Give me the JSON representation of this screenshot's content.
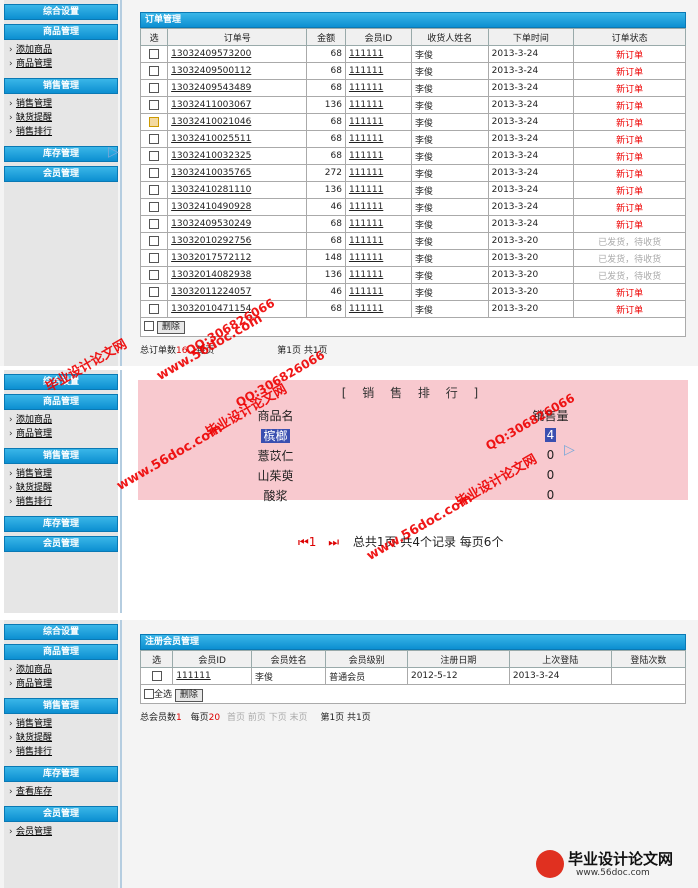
{
  "sidebar1": {
    "sections": [
      {
        "header": "综合设置",
        "items": []
      },
      {
        "header": "商品管理",
        "items": [
          "添加商品",
          "商品管理"
        ]
      },
      {
        "header": "销售管理",
        "items": [
          "销售管理",
          "缺货提醒",
          "销售排行"
        ]
      },
      {
        "header": "库存管理",
        "items": []
      },
      {
        "header": "会员管理",
        "items": []
      }
    ]
  },
  "orders": {
    "title": "订单管理",
    "columns": [
      "选",
      "订单号",
      "金额",
      "会员ID",
      "收货人姓名",
      "下单时间",
      "订单状态"
    ],
    "rows": [
      {
        "id": "13032409573200",
        "amount": "68",
        "member": "111111",
        "name": "李俊",
        "date": "2013-3-24",
        "status": "新订单"
      },
      {
        "id": "13032409500112",
        "amount": "68",
        "member": "111111",
        "name": "李俊",
        "date": "2013-3-24",
        "status": "新订单"
      },
      {
        "id": "13032409543489",
        "amount": "68",
        "member": "111111",
        "name": "李俊",
        "date": "2013-3-24",
        "status": "新订单"
      },
      {
        "id": "13032411003067",
        "amount": "136",
        "member": "111111",
        "name": "李俊",
        "date": "2013-3-24",
        "status": "新订单"
      },
      {
        "id": "13032410021046",
        "amount": "68",
        "member": "111111",
        "name": "李俊",
        "date": "2013-3-24",
        "status": "新订单"
      },
      {
        "id": "13032410025511",
        "amount": "68",
        "member": "111111",
        "name": "李俊",
        "date": "2013-3-24",
        "status": "新订单"
      },
      {
        "id": "13032410032325",
        "amount": "68",
        "member": "111111",
        "name": "李俊",
        "date": "2013-3-24",
        "status": "新订单"
      },
      {
        "id": "13032410035765",
        "amount": "272",
        "member": "111111",
        "name": "李俊",
        "date": "2013-3-24",
        "status": "新订单"
      },
      {
        "id": "13032410281110",
        "amount": "136",
        "member": "111111",
        "name": "李俊",
        "date": "2013-3-24",
        "status": "新订单"
      },
      {
        "id": "13032410490928",
        "amount": "46",
        "member": "111111",
        "name": "李俊",
        "date": "2013-3-24",
        "status": "新订单"
      },
      {
        "id": "13032409530249",
        "amount": "68",
        "member": "111111",
        "name": "李俊",
        "date": "2013-3-24",
        "status": "新订单"
      },
      {
        "id": "13032010292756",
        "amount": "68",
        "member": "111111",
        "name": "李俊",
        "date": "2013-3-20",
        "status": "已发货，待收货"
      },
      {
        "id": "13032017572112",
        "amount": "148",
        "member": "111111",
        "name": "李俊",
        "date": "2013-3-20",
        "status": "已发货，待收货"
      },
      {
        "id": "13032014082938",
        "amount": "136",
        "member": "111111",
        "name": "李俊",
        "date": "2013-3-20",
        "status": "已发货，待收货"
      },
      {
        "id": "13032011224057",
        "amount": "46",
        "member": "111111",
        "name": "李俊",
        "date": "2013-3-20",
        "status": "新订单"
      },
      {
        "id": "13032010471154",
        "amount": "68",
        "member": "111111",
        "name": "李俊",
        "date": "2013-3-20",
        "status": "新订单"
      }
    ],
    "delete_label": "删除",
    "footer_prefix": "总订单数",
    "footer_count": "16",
    "footer_perpage": "每页",
    "footer_page": "第1页 共1页"
  },
  "sidebar2": {
    "sections": [
      {
        "header": "综合设置",
        "items": []
      },
      {
        "header": "商品管理",
        "items": [
          "添加商品",
          "商品管理"
        ]
      },
      {
        "header": "销售管理",
        "items": [
          "销售管理",
          "缺货提醒",
          "销售排行"
        ]
      },
      {
        "header": "库存管理",
        "items": []
      },
      {
        "header": "会员管理",
        "items": []
      }
    ]
  },
  "ranking": {
    "title": "[ 销 售 排 行 ]",
    "col_name": "商品名",
    "col_qty": "销售量",
    "rows": [
      {
        "name": "槟榔",
        "qty": "4"
      },
      {
        "name": "薏苡仁",
        "qty": "0"
      },
      {
        "name": "山茱萸",
        "qty": "0"
      },
      {
        "name": "酸浆",
        "qty": "0"
      }
    ],
    "pager_first": "⏮1",
    "pager_last": "⏭",
    "pager_text": "总共1页 共4个记录 每页6个"
  },
  "sidebar3": {
    "sections": [
      {
        "header": "综合设置",
        "items": []
      },
      {
        "header": "商品管理",
        "items": [
          "添加商品",
          "商品管理"
        ]
      },
      {
        "header": "销售管理",
        "items": [
          "销售管理",
          "缺货提醒",
          "销售排行"
        ]
      },
      {
        "header": "库存管理",
        "items": [
          "查看库存"
        ]
      },
      {
        "header": "会员管理",
        "items": [
          "会员管理"
        ]
      }
    ]
  },
  "members": {
    "title": "注册会员管理",
    "columns": [
      "选",
      "会员ID",
      "会员姓名",
      "会员级别",
      "注册日期",
      "上次登陆",
      "登陆次数"
    ],
    "rows": [
      {
        "id": "111111",
        "name": "李俊",
        "level": "普通会员",
        "reg": "2012-5-12",
        "last": "2013-3-24",
        "count": ""
      }
    ],
    "select_all": "全选",
    "delete_label": "删除",
    "footer_prefix": "总会员数",
    "footer_count": "1",
    "footer_perpage": "每页",
    "footer_perpage_num": "20",
    "footer_nav": "首页 前页 下页 末页",
    "footer_page": "第1页 共1页"
  },
  "watermarks": {
    "site": "www.56doc.com",
    "qq": "QQ:306826066",
    "brand": "毕业设计论文网"
  },
  "logo": {
    "title": "毕业设计论文网",
    "url": "www.56doc.com"
  }
}
